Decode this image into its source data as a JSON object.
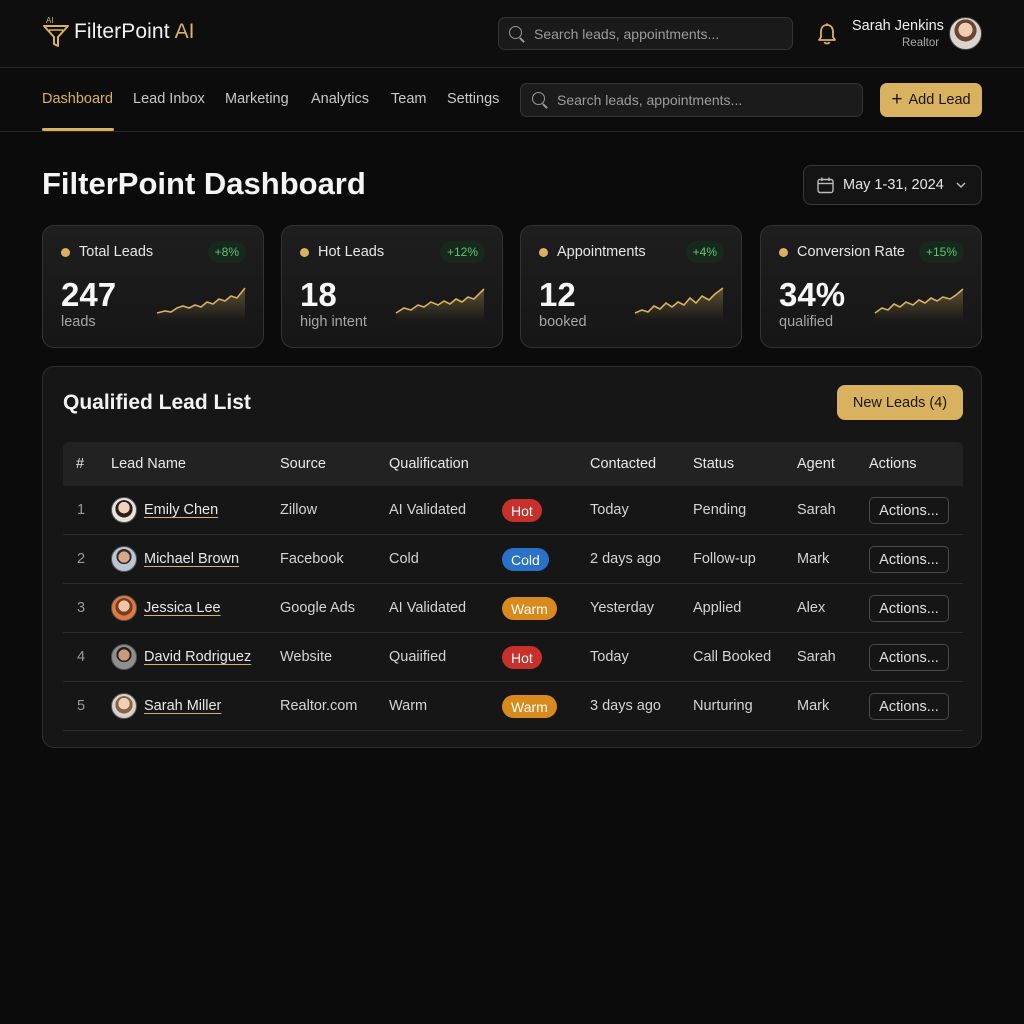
{
  "app": {
    "logo_badge": "AI",
    "name": "FilterPoint",
    "name_suffix": "AI"
  },
  "topbar": {
    "search_placeholder": "Search leads, appointments...",
    "user_name": "Sarah Jenkins",
    "user_role": "Realtor"
  },
  "nav": {
    "tabs": [
      "Dashboard",
      "Lead Inbox",
      "Marketing",
      "Analytics",
      "Team",
      "Settings"
    ],
    "active_tab": "Dashboard",
    "search_placeholder": "Search leads, appointments...",
    "add_button": "Add Lead"
  },
  "header": {
    "title": "FilterPoint Dashboard",
    "date_range": "May 1-31, 2024"
  },
  "stats": [
    {
      "label": "Total Leads",
      "delta": "+8%",
      "value": "247",
      "sub": "leads"
    },
    {
      "label": "Hot Leads",
      "delta": "+12%",
      "value": "18",
      "sub": "high intent"
    },
    {
      "label": "Appointments",
      "delta": "+4%",
      "value": "12",
      "sub": "booked"
    },
    {
      "label": "Conversion Rate",
      "delta": "+15%",
      "value": "34%",
      "sub": "qualified"
    }
  ],
  "lead_list": {
    "title": "Qualified Lead List",
    "new_leads_button": "New Leads (4)",
    "columns": [
      "#",
      "Lead Name",
      "Source",
      "Qualification",
      "Contacted",
      "Status",
      "Agent",
      "Actions"
    ],
    "rows": [
      {
        "num": "1",
        "name": "Emily Chen",
        "source": "Zillow",
        "qualification": "AI Validated",
        "tag": "Hot",
        "contacted": "Today",
        "status": "Pending",
        "agent": "Sarah",
        "action": "Actions..."
      },
      {
        "num": "2",
        "name": "Michael Brown",
        "source": "Facebook",
        "qualification": "Cold",
        "tag": "Cold",
        "contacted": "2 days ago",
        "status": "Follow-up",
        "agent": "Mark",
        "action": "Actions..."
      },
      {
        "num": "3",
        "name": "Jessica Lee",
        "source": "Google Ads",
        "qualification": "AI Validated",
        "tag": "Warm",
        "contacted": "Yesterday",
        "status": "Applied",
        "agent": "Alex",
        "action": "Actions..."
      },
      {
        "num": "4",
        "name": "David Rodriguez",
        "source": "Website",
        "qualification": "Quaiified",
        "tag": "Hot",
        "contacted": "Today",
        "status": "Call Booked",
        "agent": "Sarah",
        "action": "Actions..."
      },
      {
        "num": "5",
        "name": "Sarah Miller",
        "source": "Realtor.com",
        "qualification": "Warm",
        "tag": "Warm",
        "contacted": "3 days ago",
        "status": "Nurturing",
        "agent": "Mark",
        "action": "Actions..."
      }
    ]
  },
  "colors": {
    "accent": "#d8b25e",
    "hot": "#c8302c",
    "cold": "#2873c9",
    "warm": "#d98a1c",
    "positive": "#5fc27a"
  }
}
